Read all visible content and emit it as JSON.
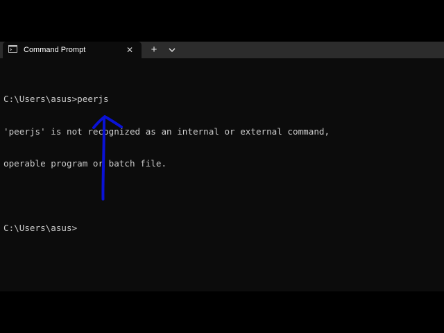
{
  "window": {
    "tab_title": "Command Prompt",
    "tab_icon": "terminal-icon",
    "close_icon": "close-icon",
    "new_tab_icon": "plus-icon",
    "dropdown_icon": "chevron-down-icon"
  },
  "console": {
    "lines": [
      "C:\\Users\\asus>peerjs",
      "'peerjs' is not recognized as an internal or external command,",
      "operable program or batch file.",
      "",
      "C:\\Users\\asus>"
    ]
  },
  "colors": {
    "background": "#0c0c0c",
    "tabbar": "#2c2c2c",
    "text": "#cccccc",
    "annotation_arrow": "#0a12d6"
  },
  "annotation": {
    "icon": "arrow-up-icon"
  }
}
